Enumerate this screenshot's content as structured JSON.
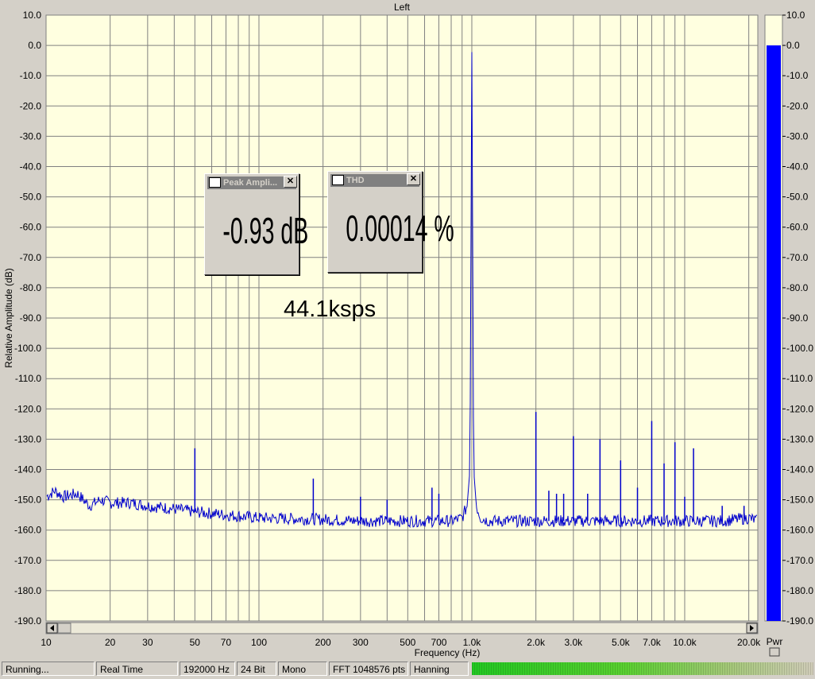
{
  "window": {
    "channel_title": "Left"
  },
  "colors": {
    "plot_bg": "#ffffe0",
    "trace": "#0000cc",
    "grid": "#808080",
    "bar": "#0000ff"
  },
  "chart_data": {
    "type": "line",
    "title": "Left",
    "xlabel": "Frequency (Hz)",
    "ylabel": "Relative Amplitude (dB)",
    "xscale": "log",
    "xlim": [
      10,
      22050
    ],
    "ylim": [
      -190,
      10
    ],
    "grid": true,
    "x_tick_labels": [
      {
        "v": 10,
        "t": "10"
      },
      {
        "v": 20,
        "t": "20"
      },
      {
        "v": 30,
        "t": "30"
      },
      {
        "v": 50,
        "t": "50"
      },
      {
        "v": 70,
        "t": "70"
      },
      {
        "v": 100,
        "t": "100"
      },
      {
        "v": 200,
        "t": "200"
      },
      {
        "v": 300,
        "t": "300"
      },
      {
        "v": 500,
        "t": "500"
      },
      {
        "v": 700,
        "t": "700"
      },
      {
        "v": 1000,
        "t": "1.0k"
      },
      {
        "v": 2000,
        "t": "2.0k"
      },
      {
        "v": 3000,
        "t": "3.0k"
      },
      {
        "v": 5000,
        "t": "5.0k"
      },
      {
        "v": 7000,
        "t": "7.0k"
      },
      {
        "v": 10000,
        "t": "10.0k"
      },
      {
        "v": 20000,
        "t": "20.0k"
      }
    ],
    "y_ticks": [
      10,
      0,
      -10,
      -20,
      -30,
      -40,
      -50,
      -60,
      -70,
      -80,
      -90,
      -100,
      -110,
      -120,
      -130,
      -140,
      -150,
      -160,
      -170,
      -180,
      -190
    ],
    "noise_floor_points": [
      [
        10,
        -149
      ],
      [
        11,
        -147
      ],
      [
        12,
        -149
      ],
      [
        14,
        -148
      ],
      [
        16,
        -152
      ],
      [
        18,
        -150
      ],
      [
        20,
        -151
      ],
      [
        25,
        -151
      ],
      [
        30,
        -152
      ],
      [
        40,
        -153
      ],
      [
        50,
        -154
      ],
      [
        60,
        -154.5
      ],
      [
        70,
        -155
      ],
      [
        100,
        -156
      ],
      [
        200,
        -156.5
      ],
      [
        300,
        -157
      ],
      [
        400,
        -157
      ],
      [
        600,
        -157
      ],
      [
        800,
        -157
      ],
      [
        900,
        -156
      ],
      [
        950,
        -152
      ],
      [
        980,
        -140
      ],
      [
        1000,
        -1
      ],
      [
        1020,
        -140
      ],
      [
        1050,
        -152
      ],
      [
        1100,
        -156
      ],
      [
        1200,
        -157
      ],
      [
        1500,
        -157
      ],
      [
        2000,
        -157
      ],
      [
        5000,
        -157
      ],
      [
        10000,
        -157
      ],
      [
        15000,
        -157
      ],
      [
        20000,
        -156
      ],
      [
        22050,
        -157
      ]
    ],
    "peaks": [
      {
        "x": 50,
        "y": -133
      },
      {
        "x": 180,
        "y": -143
      },
      {
        "x": 300,
        "y": -149
      },
      {
        "x": 400,
        "y": -150
      },
      {
        "x": 650,
        "y": -146
      },
      {
        "x": 700,
        "y": -148
      },
      {
        "x": 1000,
        "y": -1
      },
      {
        "x": 2000,
        "y": -121
      },
      {
        "x": 2300,
        "y": -147
      },
      {
        "x": 2500,
        "y": -148
      },
      {
        "x": 2700,
        "y": -148
      },
      {
        "x": 3000,
        "y": -129
      },
      {
        "x": 3500,
        "y": -148
      },
      {
        "x": 4000,
        "y": -130
      },
      {
        "x": 5000,
        "y": -137
      },
      {
        "x": 6000,
        "y": -146
      },
      {
        "x": 7000,
        "y": -124
      },
      {
        "x": 8000,
        "y": -138
      },
      {
        "x": 9000,
        "y": -131
      },
      {
        "x": 10000,
        "y": -149
      },
      {
        "x": 11000,
        "y": -133
      },
      {
        "x": 15000,
        "y": -152
      },
      {
        "x": 19000,
        "y": -152
      }
    ]
  },
  "power_meter": {
    "label": "Pwr",
    "level_db": 0,
    "scale_labels": [
      "10.0",
      "0.0",
      "-10.0",
      "-20.0",
      "-30.0",
      "-40.0",
      "-50.0",
      "-60.0",
      "-70.0",
      "-80.0",
      "-90.0",
      "-100.0",
      "-110.0",
      "-120.0",
      "-130.0",
      "-140.0",
      "-150.0",
      "-160.0",
      "-170.0",
      "-180.0",
      "-190.0"
    ]
  },
  "peak_window": {
    "title": "Peak Ampli...",
    "value": "-0.93 dB"
  },
  "thd_window": {
    "title": "THD",
    "value": "0.00014 %"
  },
  "annotation": "44.1ksps",
  "status": {
    "state": "Running...",
    "mode": "Real Time",
    "rate": "192000 Hz",
    "bits": "24 Bit",
    "channels": "Mono",
    "fft": "FFT 1048576 pts",
    "window": "Hanning"
  }
}
